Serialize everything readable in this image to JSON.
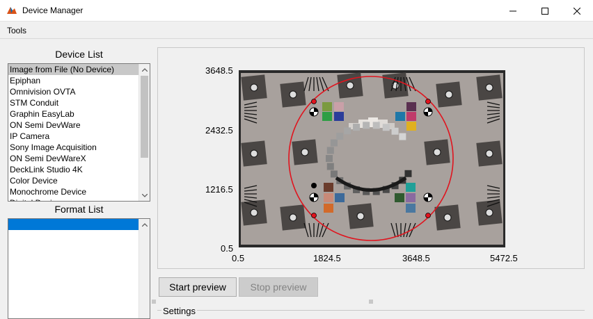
{
  "window": {
    "title": "Device Manager"
  },
  "menu": {
    "items": [
      "Tools"
    ]
  },
  "device_list": {
    "title": "Device List",
    "items": [
      "Image from File (No Device)",
      "Epiphan",
      "Omnivision OVTA",
      "STM Conduit",
      "Graphin EasyLab",
      "ON Semi DevWare",
      "IP Camera",
      "Sony Image Acquisition",
      "ON Semi DevWareX",
      "DeckLink Studio 4K",
      "Color Device",
      "Monochrome Device",
      "Digital Device"
    ],
    "selected_index": 0
  },
  "format_list": {
    "title": "Format List",
    "items": [
      ""
    ]
  },
  "preview": {
    "y_ticks": [
      "3648.5",
      "2432.5",
      "1216.5",
      "0.5"
    ],
    "x_ticks": [
      "0.5",
      "1824.5",
      "3648.5",
      "5472.5"
    ]
  },
  "buttons": {
    "start_preview": "Start preview",
    "stop_preview": "Stop preview"
  },
  "settings": {
    "title": "Settings"
  },
  "colors": {
    "selection_gray": "#c8c8c8",
    "selection_blue": "#0078d7",
    "roi_red": "#e0141e"
  }
}
